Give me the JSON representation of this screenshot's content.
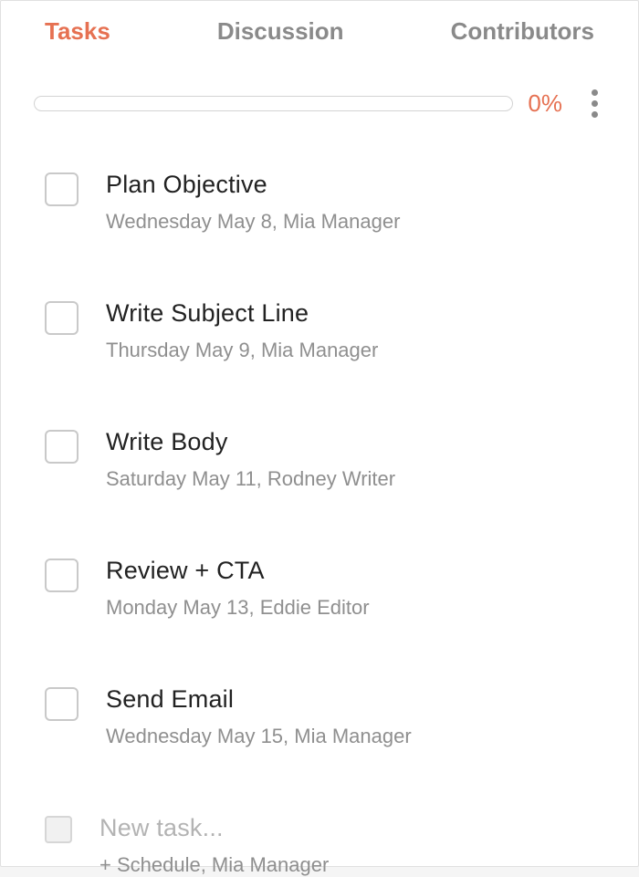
{
  "tabs": {
    "tasks": "Tasks",
    "discussion": "Discussion",
    "contributors": "Contributors"
  },
  "progress": {
    "percent_label": "0%"
  },
  "tasks": [
    {
      "title": "Plan Objective",
      "meta": "Wednesday May 8,   Mia Manager"
    },
    {
      "title": "Write Subject Line",
      "meta": "Thursday May 9,   Mia Manager"
    },
    {
      "title": "Write Body",
      "meta": "Saturday May 11,   Rodney Writer"
    },
    {
      "title": "Review + CTA",
      "meta": "Monday May 13,   Eddie Editor"
    },
    {
      "title": "Send Email",
      "meta": "Wednesday May 15,   Mia Manager"
    }
  ],
  "new_task": {
    "placeholder": "New task...",
    "meta": "+ Schedule,   Mia Manager"
  }
}
